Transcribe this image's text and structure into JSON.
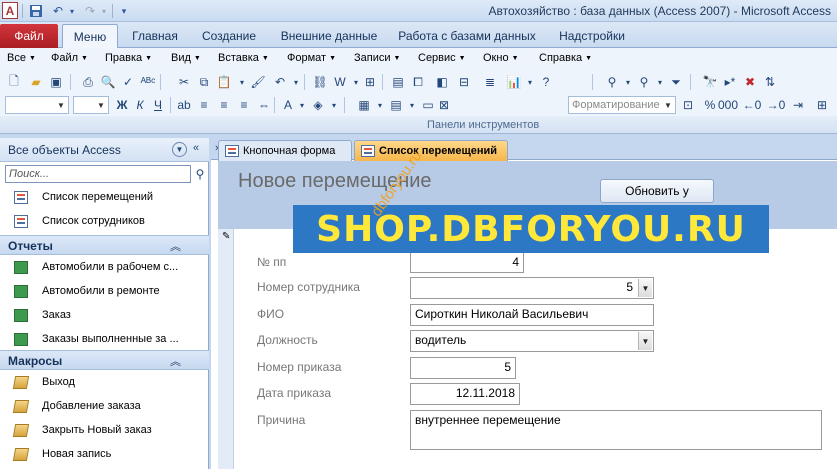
{
  "window": {
    "title": "Автохозяйство : база данных (Access 2007)  -  Microsoft Access",
    "qat_icons": [
      "access-logo-icon",
      "save-icon",
      "undo-icon",
      "redo-icon",
      "customize-qat-icon"
    ]
  },
  "ribbon": {
    "file_tab": "Файл",
    "tabs": [
      "Меню",
      "Главная",
      "Создание",
      "Внешние данные",
      "Работа с базами данных",
      "Надстройки"
    ]
  },
  "menubar": {
    "items": [
      "Все",
      "Файл",
      "Правка",
      "Вид",
      "Вставка",
      "Формат",
      "Записи",
      "Сервис",
      "Окно",
      "Справка"
    ]
  },
  "toolbar": {
    "format_combo": "Форматирование",
    "group_caption": "Панели инструментов"
  },
  "navpane": {
    "title": "Все объекты Access",
    "search_placeholder": "Поиск...",
    "forms": [
      {
        "label": "Список перемещений"
      },
      {
        "label": "Список сотрудников"
      }
    ],
    "reports_group": "Отчеты",
    "reports": [
      {
        "label": "Автомобили в рабочем с..."
      },
      {
        "label": "Автомобили в ремонте"
      },
      {
        "label": "Заказ"
      },
      {
        "label": "Заказы выполненные за ..."
      }
    ],
    "macros_group": "Макросы",
    "macros": [
      {
        "label": "Выход"
      },
      {
        "label": "Добавление заказа"
      },
      {
        "label": "Закрыть Новый заказ"
      },
      {
        "label": "Новая запись"
      }
    ]
  },
  "doc_tabs": [
    {
      "label": "Кнопочная форма",
      "active": false
    },
    {
      "label": "Список перемещений",
      "active": true
    }
  ],
  "form": {
    "title": "Новое перемещение",
    "refresh_button": "Обновить у",
    "fields": {
      "record_no": {
        "label": "№ пп",
        "value": "4"
      },
      "employee_no": {
        "label": "Номер сотрудника",
        "value": "5"
      },
      "fio": {
        "label": "ФИО",
        "value": "Сироткин Николай Васильевич"
      },
      "position": {
        "label": "Должность",
        "value": "водитель"
      },
      "order_no": {
        "label": "Номер приказа",
        "value": "5"
      },
      "order_date": {
        "label": "Дата приказа",
        "value": "12.11.2018"
      },
      "reason": {
        "label": "Причина",
        "value": "внутреннее перемещение"
      }
    }
  },
  "watermark": {
    "banner": "SHOP.DBFORYOU.RU",
    "diagonal": "dbforyou.ru"
  },
  "colors": {
    "file_tab": "#b8262c",
    "active_doc_tab": "#f6b64b",
    "form_header": "#b7cbe6",
    "watermark_bg": "#2c78c5",
    "watermark_text": "#ffe83a"
  }
}
